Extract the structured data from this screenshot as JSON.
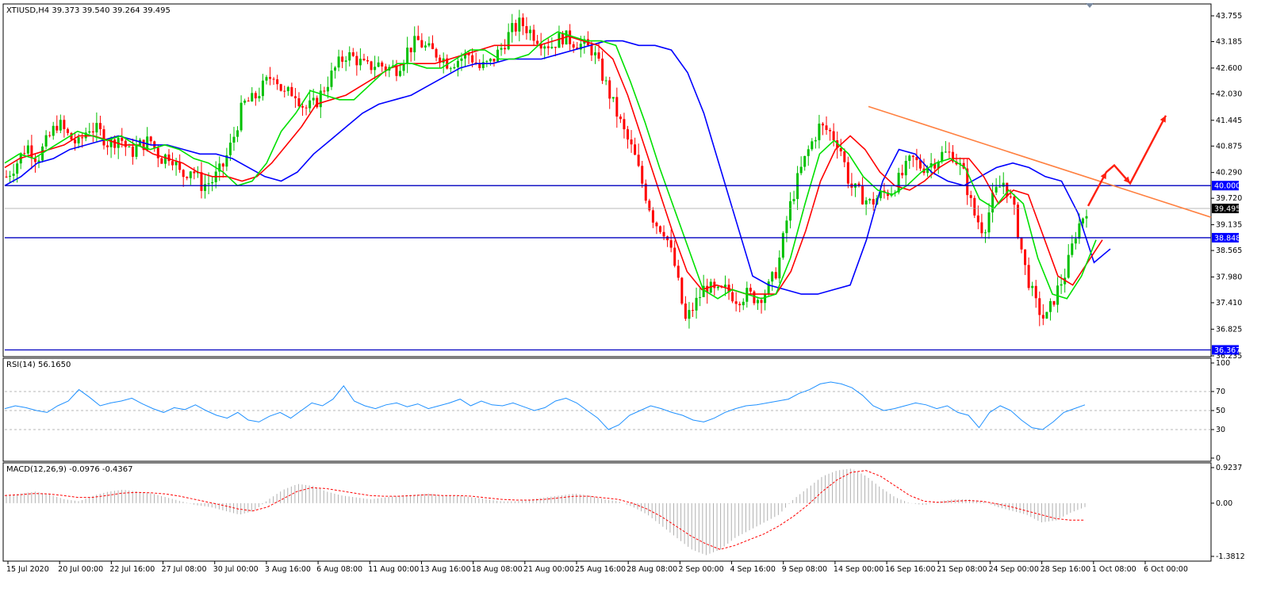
{
  "header": {
    "main": "XTIUSD,H4  39.373 39.540 39.264 39.495",
    "rsi": "RSI(14) 56.1650",
    "macd": "MACD(12,26,9) -0.0976 -0.4367"
  },
  "colors": {
    "bull": "#00c000",
    "bear": "#ff0000",
    "ma_fast": "#00e000",
    "ma_mid": "#ff0000",
    "ma_slow": "#0000ff",
    "hline": "#0000c0",
    "trendline": "#ff8040",
    "arrows": "#ff2010",
    "rsi": "#1e90ff",
    "macd_hist": "#b0b0b0",
    "macd_signal": "#ff0000",
    "level_box": "#0000ff",
    "current_box": "#000000"
  },
  "chart_data": [
    {
      "type": "candlestick",
      "symbol": "XTIUSD",
      "timeframe": "H4",
      "ohlc_last": {
        "open": 39.373,
        "high": 39.54,
        "low": 39.264,
        "close": 39.495
      },
      "ylim": [
        36.235,
        44.0
      ],
      "y_ticks": [
        "43.755",
        "43.185",
        "42.600",
        "42.030",
        "41.445",
        "40.875",
        "40.290",
        "39.720",
        "39.135",
        "38.565",
        "37.980",
        "37.410",
        "36.825",
        "36.235"
      ],
      "x_ticks": [
        "15 Jul 2020",
        "20 Jul 00:00",
        "22 Jul 16:00",
        "27 Jul 08:00",
        "30 Jul 00:00",
        "3 Aug 16:00",
        "6 Aug 08:00",
        "11 Aug 00:00",
        "13 Aug 16:00",
        "18 Aug 08:00",
        "21 Aug 00:00",
        "25 Aug 16:00",
        "28 Aug 08:00",
        "2 Sep 00:00",
        "4 Sep 16:00",
        "9 Sep 08:00",
        "14 Sep 00:00",
        "16 Sep 16:00",
        "21 Sep 08:00",
        "24 Sep 00:00",
        "28 Sep 16:00",
        "1 Oct 08:00",
        "6 Oct 00:00"
      ],
      "close_path": [
        40.2,
        40.5,
        40.9,
        40.6,
        41.0,
        41.4,
        41.1,
        40.9,
        41.3,
        41.2,
        40.9,
        41.1,
        40.7,
        40.9,
        41.0,
        40.6,
        40.7,
        40.2,
        40.4,
        40.0,
        40.1,
        40.4,
        41.0,
        41.8,
        41.9,
        42.2,
        42.5,
        42.0,
        42.1,
        41.7,
        41.8,
        42.2,
        42.6,
        42.9,
        42.8,
        42.6,
        42.7,
        42.6,
        42.6,
        43.0,
        43.2,
        43.0,
        42.9,
        42.7,
        42.8,
        42.9,
        42.6,
        42.7,
        43.0,
        43.4,
        43.6,
        43.4,
        43.2,
        43.1,
        43.3,
        43.2,
        43.1,
        43.0,
        42.4,
        41.8,
        41.2,
        40.7,
        39.9,
        39.2,
        39.0,
        38.2,
        37.0,
        37.4,
        37.8,
        37.6,
        37.7,
        37.5,
        37.6,
        37.5,
        37.7,
        38.2,
        39.4,
        40.2,
        40.8,
        41.3,
        41.2,
        40.9,
        40.0,
        39.8,
        39.6,
        39.8,
        39.9,
        40.2,
        40.6,
        40.4,
        40.5,
        40.7,
        40.7,
        40.3,
        39.4,
        39.0,
        39.8,
        40.1,
        39.4,
        38.2,
        37.4,
        37.0,
        37.6,
        38.1,
        39.0,
        39.495
      ],
      "ma_fast_path": [
        40.5,
        40.7,
        40.6,
        40.8,
        41.0,
        41.2,
        41.1,
        41.0,
        41.1,
        40.9,
        40.8,
        40.9,
        40.8,
        40.6,
        40.5,
        40.3,
        40.0,
        40.1,
        40.5,
        41.2,
        41.6,
        42.1,
        42.0,
        41.9,
        41.9,
        42.2,
        42.5,
        42.7,
        42.7,
        42.6,
        42.6,
        42.8,
        43.0,
        43.0,
        42.8,
        42.8,
        42.9,
        43.2,
        43.4,
        43.3,
        43.2,
        43.2,
        43.1,
        42.3,
        41.4,
        40.4,
        39.5,
        38.6,
        37.7,
        37.5,
        37.7,
        37.6,
        37.5,
        37.6,
        38.4,
        39.6,
        40.7,
        41.0,
        40.7,
        40.2,
        39.9,
        39.8,
        40.0,
        40.3,
        40.5,
        40.6,
        40.4,
        39.7,
        39.5,
        39.9,
        39.6,
        38.4,
        37.6,
        37.5,
        38.0,
        38.8
      ],
      "ma_mid_path": [
        40.4,
        40.6,
        40.7,
        40.8,
        40.9,
        41.1,
        41.1,
        41.0,
        40.9,
        40.9,
        40.7,
        40.6,
        40.5,
        40.3,
        40.2,
        40.2,
        40.1,
        40.2,
        40.5,
        40.9,
        41.3,
        41.8,
        41.9,
        42.0,
        42.2,
        42.4,
        42.6,
        42.7,
        42.7,
        42.7,
        42.8,
        42.9,
        43.0,
        43.1,
        43.1,
        43.1,
        43.1,
        43.2,
        43.3,
        43.2,
        43.1,
        42.8,
        42.0,
        41.0,
        40.0,
        39.0,
        38.1,
        37.7,
        37.8,
        37.7,
        37.6,
        37.6,
        37.6,
        38.1,
        39.0,
        40.1,
        40.8,
        41.1,
        40.8,
        40.3,
        40.0,
        39.9,
        40.1,
        40.4,
        40.6,
        40.6,
        40.2,
        39.6,
        39.9,
        39.8,
        38.9,
        38.0,
        37.8,
        38.3,
        38.8
      ],
      "ma_slow_path": [
        40.0,
        40.2,
        40.5,
        40.6,
        40.8,
        40.9,
        41.0,
        41.1,
        41.0,
        40.9,
        40.9,
        40.8,
        40.7,
        40.7,
        40.6,
        40.4,
        40.2,
        40.1,
        40.3,
        40.7,
        41.0,
        41.3,
        41.6,
        41.8,
        41.9,
        42.0,
        42.2,
        42.4,
        42.6,
        42.7,
        42.7,
        42.8,
        42.8,
        42.8,
        42.9,
        43.0,
        43.1,
        43.2,
        43.2,
        43.1,
        43.1,
        43.0,
        42.5,
        41.6,
        40.4,
        39.2,
        38.0,
        37.8,
        37.7,
        37.6,
        37.6,
        37.7,
        37.8,
        38.8,
        40.1,
        40.8,
        40.7,
        40.3,
        40.1,
        40.0,
        40.2,
        40.4,
        40.5,
        40.4,
        40.2,
        40.1,
        39.4,
        38.3,
        38.6
      ]
    },
    {
      "type": "line",
      "name": "RSI(14)",
      "value": 56.165,
      "ylim": [
        0,
        100
      ],
      "levels": [
        70,
        50,
        30
      ],
      "y_ticks": [
        "100",
        "70",
        "50",
        "30",
        "0"
      ],
      "values": [
        52,
        55,
        53,
        50,
        48,
        55,
        60,
        72,
        64,
        55,
        58,
        60,
        63,
        57,
        52,
        48,
        53,
        51,
        56,
        50,
        45,
        42,
        48,
        40,
        38,
        44,
        48,
        42,
        50,
        58,
        55,
        62,
        76,
        60,
        55,
        52,
        56,
        58,
        54,
        57,
        52,
        55,
        58,
        62,
        55,
        60,
        56,
        55,
        58,
        54,
        50,
        53,
        60,
        63,
        58,
        50,
        42,
        30,
        35,
        45,
        50,
        55,
        52,
        48,
        45,
        40,
        38,
        42,
        48,
        52,
        55,
        56,
        58,
        60,
        62,
        68,
        72,
        78,
        80,
        78,
        74,
        66,
        55,
        50,
        52,
        55,
        58,
        56,
        52,
        55,
        48,
        45,
        32,
        48,
        55,
        50,
        40,
        32,
        30,
        38,
        48,
        52,
        56
      ]
    },
    {
      "type": "bar+line",
      "name": "MACD(12,26,9)",
      "main": -0.0976,
      "signal": -0.4367,
      "ylim": [
        -1.3812,
        0.9237
      ],
      "y_ticks": [
        "0.9237",
        "0.00",
        "-1.3812"
      ],
      "hist": [
        0.2,
        0.25,
        0.3,
        0.22,
        0.1,
        0.05,
        0.2,
        0.3,
        0.35,
        0.3,
        0.25,
        0.15,
        0.05,
        -0.05,
        -0.1,
        -0.2,
        -0.3,
        -0.2,
        0.1,
        0.35,
        0.5,
        0.45,
        0.3,
        0.2,
        0.15,
        0.1,
        0.15,
        0.2,
        0.22,
        0.25,
        0.2,
        0.2,
        0.15,
        0.1,
        0.05,
        0.05,
        0.1,
        0.15,
        0.2,
        0.25,
        0.2,
        0.1,
        0.05,
        -0.1,
        -0.3,
        -0.6,
        -0.9,
        -1.2,
        -1.35,
        -1.2,
        -0.9,
        -0.7,
        -0.5,
        -0.3,
        0.1,
        0.4,
        0.7,
        0.85,
        0.9,
        0.7,
        0.4,
        0.15,
        0.0,
        -0.05,
        0.05,
        0.1,
        0.1,
        0.05,
        -0.1,
        -0.2,
        -0.3,
        -0.5,
        -0.45,
        -0.25,
        -0.1
      ],
      "signal_series": [
        0.2,
        0.22,
        0.25,
        0.24,
        0.2,
        0.15,
        0.15,
        0.2,
        0.26,
        0.28,
        0.27,
        0.24,
        0.18,
        0.1,
        0.02,
        -0.06,
        -0.15,
        -0.2,
        -0.1,
        0.1,
        0.3,
        0.4,
        0.38,
        0.32,
        0.26,
        0.2,
        0.18,
        0.18,
        0.2,
        0.22,
        0.2,
        0.2,
        0.18,
        0.14,
        0.1,
        0.08,
        0.08,
        0.1,
        0.14,
        0.18,
        0.18,
        0.14,
        0.1,
        0.0,
        -0.15,
        -0.35,
        -0.6,
        -0.85,
        -1.05,
        -1.2,
        -1.1,
        -0.95,
        -0.8,
        -0.6,
        -0.35,
        -0.05,
        0.3,
        0.6,
        0.8,
        0.85,
        0.7,
        0.45,
        0.2,
        0.05,
        0.02,
        0.05,
        0.07,
        0.05,
        -0.02,
        -0.1,
        -0.2,
        -0.3,
        -0.4,
        -0.44,
        -0.44
      ]
    }
  ],
  "annotations": {
    "price_levels": [
      "40.000",
      "38.848",
      "36.367"
    ],
    "current_price": "39.495"
  }
}
